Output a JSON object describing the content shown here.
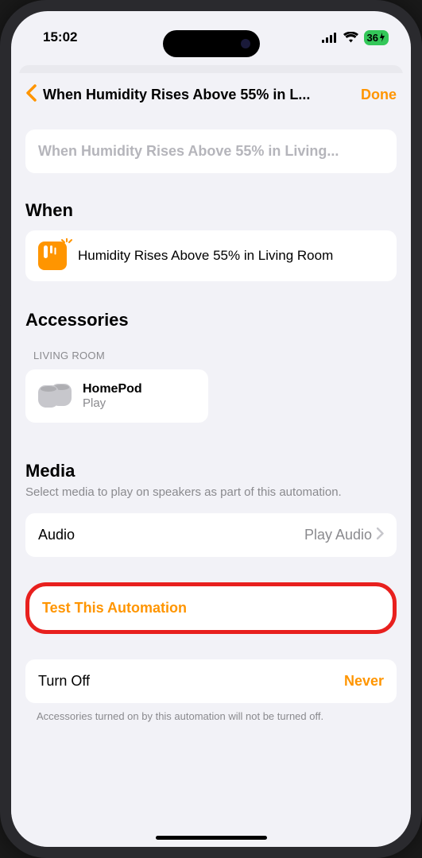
{
  "status": {
    "time": "15:02",
    "battery": "36"
  },
  "nav": {
    "title": "When Humidity Rises Above 55% in L...",
    "done": "Done"
  },
  "name_field": "When Humidity Rises Above 55% in Living...",
  "when": {
    "header": "When",
    "trigger": "Humidity Rises Above 55% in Living Room"
  },
  "accessories": {
    "header": "Accessories",
    "room": "LIVING ROOM",
    "device_name": "HomePod",
    "device_action": "Play"
  },
  "media": {
    "header": "Media",
    "description": "Select media to play on speakers as part of this automation.",
    "row_label": "Audio",
    "row_value": "Play Audio"
  },
  "test": {
    "label": "Test This Automation"
  },
  "turnoff": {
    "label": "Turn Off",
    "value": "Never",
    "note": "Accessories turned on by this automation will not be turned off."
  }
}
